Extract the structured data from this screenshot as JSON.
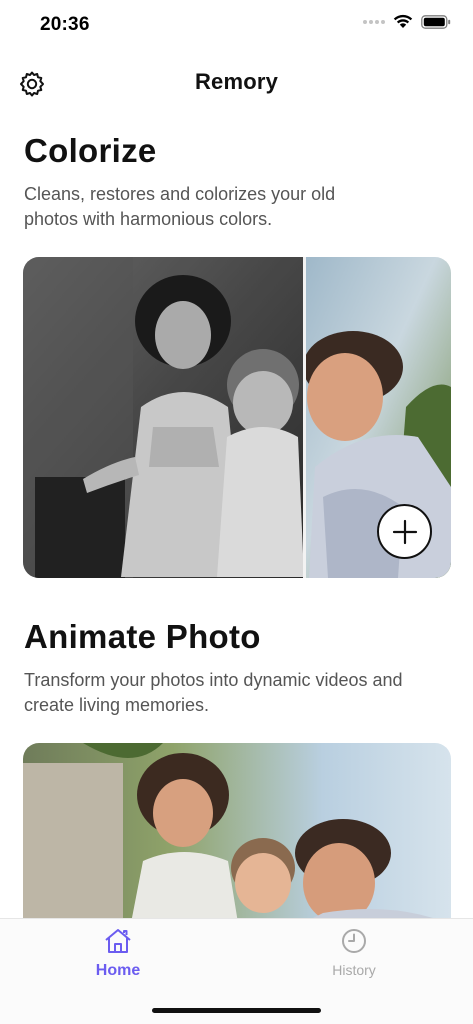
{
  "status_bar": {
    "time": "20:36",
    "wifi_icon": "wifi-icon",
    "battery_icon": "battery-icon"
  },
  "nav": {
    "title": "Remory",
    "settings_icon": "gear-icon"
  },
  "colorize": {
    "title": "Colorize",
    "description": "Cleans, restores and colorizes your old photos with harmonious colors.",
    "add_icon": "plus-icon"
  },
  "animate": {
    "title": "Animate Photo",
    "description": "Transform your photos into dynamic videos and create living memories."
  },
  "tabs": [
    {
      "label": "Home",
      "icon": "home-icon",
      "active": true
    },
    {
      "label": "History",
      "icon": "clock-icon",
      "active": false
    }
  ],
  "colors": {
    "accent": "#6b5cf0",
    "inactive": "#a9a9a9"
  }
}
